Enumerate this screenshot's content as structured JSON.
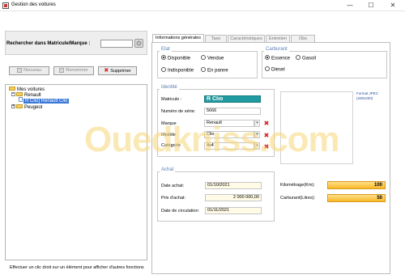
{
  "window": {
    "title": "Gestion des voitures",
    "controls": {
      "minimize": "—",
      "maximize": "☐",
      "close": "✕"
    }
  },
  "search": {
    "label": "Rechercher dans Matricule/Marque :",
    "value": ""
  },
  "actions": {
    "new_label": "Nouveau",
    "rename_label": "Renommer",
    "delete_label": "Supprimer"
  },
  "tree": {
    "root": "Mes voitures",
    "groups": [
      {
        "label": "Renault",
        "expanded": true,
        "children": [
          "R Clio] Renault Clio"
        ]
      },
      {
        "label": "Peugeot",
        "expanded": false,
        "children": []
      }
    ],
    "selected": "R Clio] Renault Clio"
  },
  "status_text": "Effectuer un clic droit sur un élément pour afficher d'autres fonctions",
  "tabs": [
    {
      "label": "Informations générales",
      "active": true
    },
    {
      "label": "Taxe",
      "active": false
    },
    {
      "label": "Caractéristiques",
      "active": false
    },
    {
      "label": "Entretien",
      "active": false
    },
    {
      "label": "Obs",
      "active": false
    }
  ],
  "etat": {
    "title": "Etat",
    "options": [
      "Disponible",
      "Vendue",
      "Indisponible",
      "En panne"
    ],
    "selected": "Disponible"
  },
  "carburant": {
    "title": "Carburant",
    "options": [
      "Essence",
      "Gasoil",
      "Diesel"
    ],
    "selected": "Essence"
  },
  "identite": {
    "title": "Identité",
    "matricule_label": "Matricule :",
    "matricule_value": "R Clio",
    "serie_label": "Numéro de série:",
    "serie_value": "5666",
    "marque_label": "Marque",
    "marque_value": "Renault",
    "modele_label": "Modèle",
    "modele_value": "Clio",
    "categorie_label": "Catégorie",
    "categorie_value": "4x4"
  },
  "photo": {
    "note": "Format JPEC (200x200)"
  },
  "achat": {
    "title": "Achat",
    "date_label": "Date achat:",
    "date_value": "01/10/2021",
    "prix_label": "Prix d'achat:",
    "prix_value": "2 000 000,00",
    "circulation_label": "Date de circulation:",
    "circulation_value": "01/11/2021"
  },
  "metrics": {
    "km_label": "Kilométrage(Km):",
    "km_value": "100",
    "carburant_label": "Carburant(Litres):",
    "carburant_value": "50"
  },
  "watermark": "Ouedkniss.com",
  "colors": {
    "accent_blue": "#3a78d6",
    "matricule_bg": "#1f9aa0",
    "orange": "#f9b827",
    "delete_red": "#d22222",
    "group_title": "#5a7fb0"
  }
}
